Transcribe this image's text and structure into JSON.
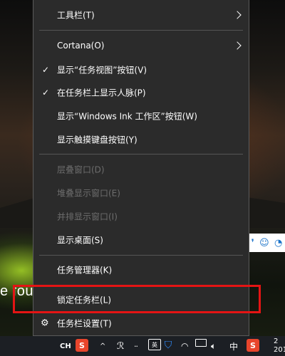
{
  "menu": {
    "items": [
      {
        "label": "工具栏(T)",
        "has_submenu": true,
        "checked": false,
        "disabled": false
      },
      {
        "label": "Cortana(O)",
        "has_submenu": true,
        "checked": false,
        "disabled": false
      },
      {
        "label": "显示“任务视图”按钮(V)",
        "has_submenu": false,
        "checked": true,
        "disabled": false
      },
      {
        "label": "在任务栏上显示人脉(P)",
        "has_submenu": false,
        "checked": true,
        "disabled": false
      },
      {
        "label": "显示“Windows Ink 工作区”按钮(W)",
        "has_submenu": false,
        "checked": false,
        "disabled": false
      },
      {
        "label": "显示触摸键盘按钮(Y)",
        "has_submenu": false,
        "checked": false,
        "disabled": false
      },
      {
        "label": "层叠窗口(D)",
        "has_submenu": false,
        "checked": false,
        "disabled": true
      },
      {
        "label": "堆叠显示窗口(E)",
        "has_submenu": false,
        "checked": false,
        "disabled": true
      },
      {
        "label": "并排显示窗口(I)",
        "has_submenu": false,
        "checked": false,
        "disabled": true
      },
      {
        "label": "显示桌面(S)",
        "has_submenu": false,
        "checked": false,
        "disabled": false
      },
      {
        "label": "任务管理器(K)",
        "has_submenu": false,
        "checked": false,
        "disabled": false
      },
      {
        "label": "锁定任务栏(L)",
        "has_submenu": false,
        "checked": false,
        "disabled": false
      },
      {
        "label": "任务栏设置(T)",
        "has_submenu": false,
        "checked": false,
        "disabled": false
      }
    ],
    "check_glyph": "✓",
    "settings_icon": "gear-icon"
  },
  "wallpaper": {
    "partial_text": "e fou"
  },
  "notification_strip": {
    "icons": [
      "comma-icon",
      "smiley-icon",
      "partial-icon"
    ]
  },
  "taskbar": {
    "ime_mode": "CH",
    "sogou_label": "S",
    "ime_badge": "英",
    "language": "中",
    "clock_partial": "2",
    "date_partial": "201"
  },
  "colors": {
    "menu_bg": "#2b2b2b",
    "highlight_border": "#e41414",
    "disabled_text": "#6d6d6d",
    "taskbar_bg": "#1c1f24"
  }
}
